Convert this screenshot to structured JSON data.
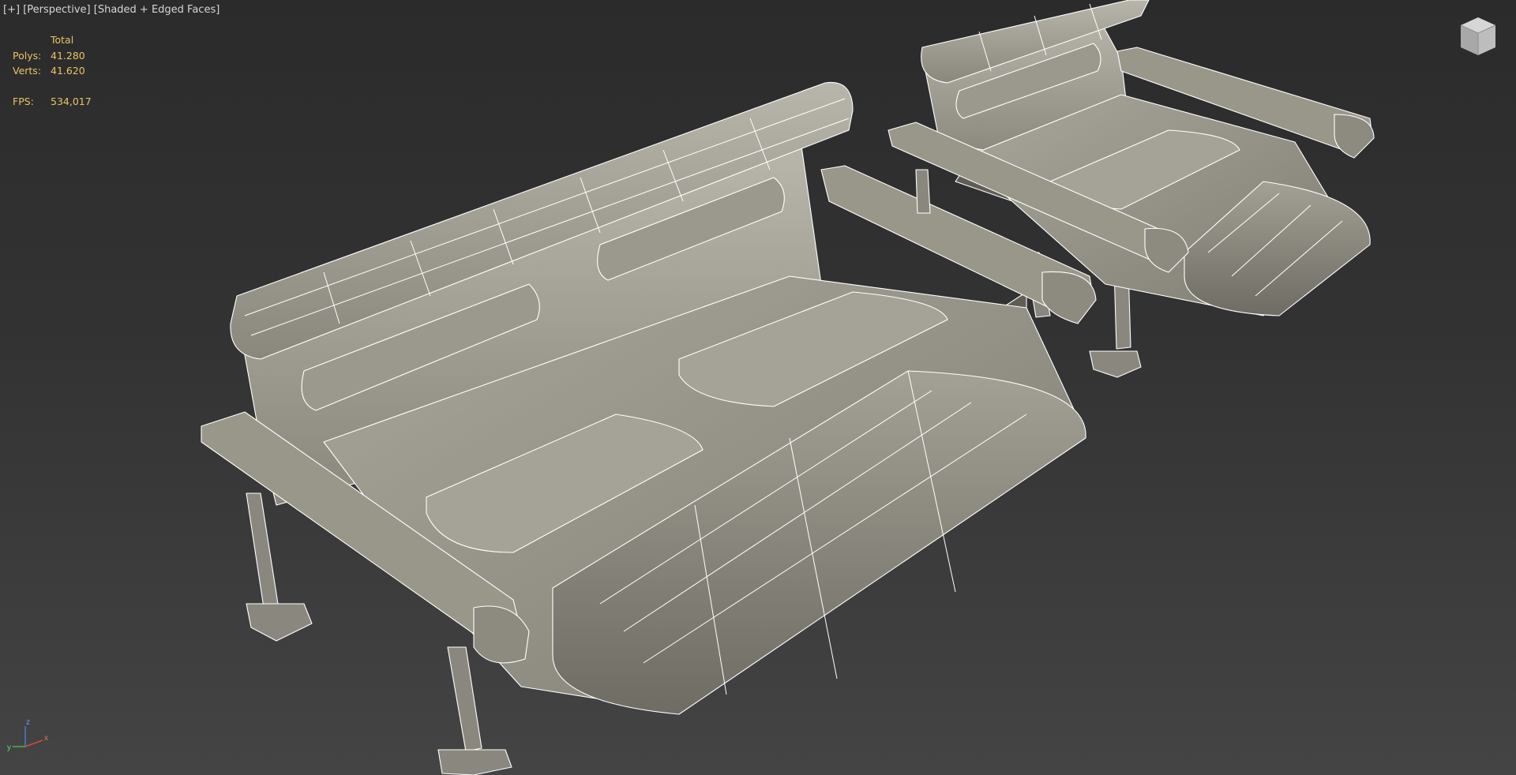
{
  "viewport": {
    "label_plus": "[+]",
    "label_view": "[Perspective]",
    "label_shading": "[Shaded + Edged Faces]"
  },
  "stats": {
    "header": "Total",
    "polys_label": "Polys:",
    "polys_value": "41.280",
    "verts_label": "Verts:",
    "verts_value": "41.620",
    "fps_label": "FPS:",
    "fps_value": "534,017"
  },
  "viewcube": {
    "icon": "viewcube-icon"
  },
  "axis": {
    "x": "x",
    "y": "y",
    "z": "z",
    "x_color": "#d04a3a",
    "y_color": "#4cb04a",
    "z_color": "#4a78d0"
  },
  "colors": {
    "mesh_fill": "#8d8b80",
    "mesh_light": "#b4b2a6",
    "mesh_dark": "#5e5c54",
    "wire": "#ffffff",
    "stats_text": "#e8c468"
  }
}
